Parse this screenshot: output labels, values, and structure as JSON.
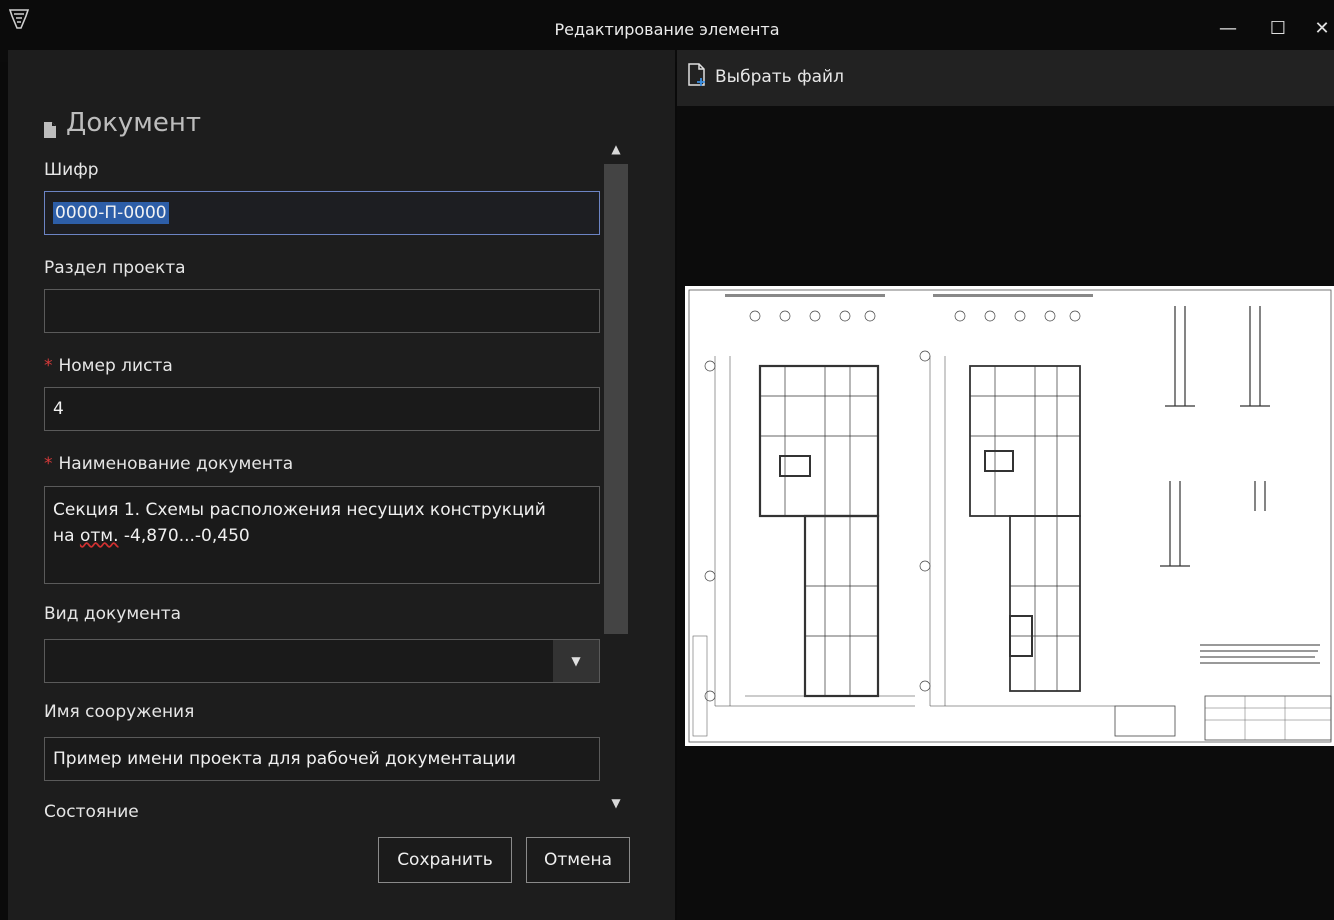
{
  "window": {
    "title": "Редактирование элемента",
    "controls": {
      "minimize": "—",
      "maximize": "☐",
      "close": "✕"
    }
  },
  "section": {
    "title": "Документ"
  },
  "form": {
    "code": {
      "label": "Шифр",
      "value": "0000-П-0000"
    },
    "section_part": {
      "label": "Раздел проекта",
      "value": ""
    },
    "sheet_number": {
      "label": "Номер листа",
      "required_mark": "*",
      "value": "4"
    },
    "doc_name": {
      "label": "Наименование документа",
      "required_mark": "*",
      "line1": "Секция 1. Схемы расположения несущих конструкций",
      "line2_prefix": "на ",
      "line2_misspelled": "отм.",
      "line2_suffix": " -4,870...-0,450"
    },
    "doc_type": {
      "label": "Вид документа",
      "value": ""
    },
    "structure_name": {
      "label": "Имя сооружения",
      "value": "Пример имени проекта для рабочей документации"
    },
    "state": {
      "label": "Состояние"
    }
  },
  "scroll": {
    "up_icon": "▲",
    "down_icon": "▼",
    "select_arrow": "▼"
  },
  "buttons": {
    "save": "Сохранить",
    "cancel": "Отмена"
  },
  "right": {
    "choose_file": "Выбрать файл"
  },
  "colors": {
    "accent_selection": "#2d5ea8",
    "required": "#d63a3a"
  }
}
